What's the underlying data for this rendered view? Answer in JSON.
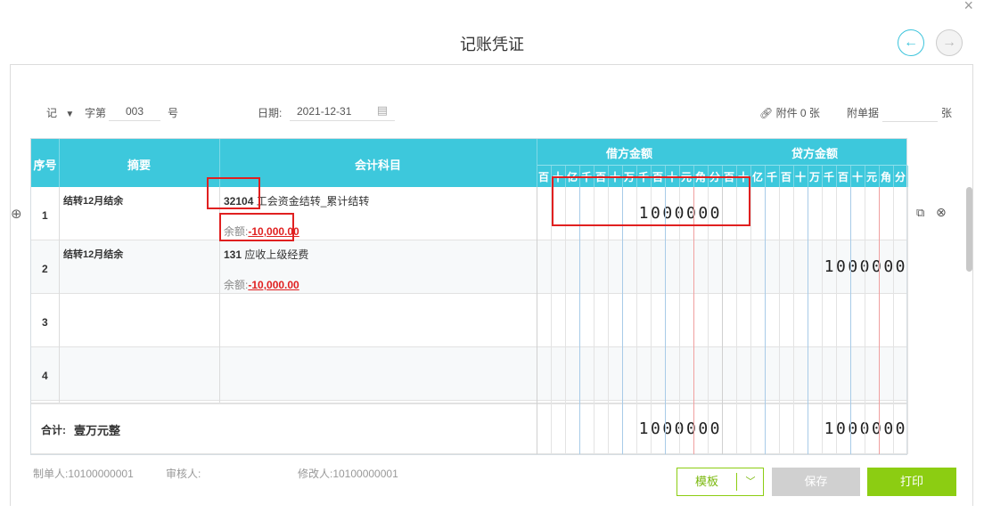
{
  "window": {
    "title": "记账凭证",
    "close_icon": "close-icon",
    "prev_icon": "arrow-left-icon",
    "next_icon": "arrow-right-icon"
  },
  "header": {
    "voucher_type": "记",
    "voucher_word": "字第",
    "voucher_no": "003",
    "voucher_hao": "号",
    "date_label": "日期:",
    "date_value": "2021-12-31",
    "attachment_icon": "link-icon",
    "attachment_text": "附件 0 张",
    "doc_label": "附单据",
    "doc_unit": "张"
  },
  "table": {
    "headers": {
      "seq": "序号",
      "summary": "摘要",
      "account": "会计科目",
      "debit": "借方金额",
      "credit": "贷方金额"
    },
    "digit_units": [
      "百",
      "十",
      "亿",
      "千",
      "百",
      "十",
      "万",
      "千",
      "百",
      "十",
      "元",
      "角",
      "分"
    ],
    "rows": [
      {
        "seq": "1",
        "summary": "结转12月结余",
        "account_code": "32104",
        "account_name": "工会资金结转_累计结转",
        "balance_label": "余额:",
        "balance_value": "-10,000.00",
        "debit": "1000000",
        "credit": ""
      },
      {
        "seq": "2",
        "summary": "结转12月结余",
        "account_code": "131",
        "account_name": "应收上级经费",
        "balance_label": "余额:",
        "balance_value": "-10,000.00",
        "debit": "",
        "credit": "1000000"
      },
      {
        "seq": "3",
        "summary": "",
        "account_code": "",
        "account_name": "",
        "balance_label": "",
        "balance_value": "",
        "debit": "",
        "credit": ""
      },
      {
        "seq": "4",
        "summary": "",
        "account_code": "",
        "account_name": "",
        "balance_label": "",
        "balance_value": "",
        "debit": "",
        "credit": ""
      }
    ],
    "total": {
      "label": "合计:",
      "amount_text": "壹万元整",
      "debit": "1000000",
      "credit": "1000000"
    }
  },
  "footer": {
    "maker": "制单人:10100000001",
    "reviewer": "审核人:",
    "modifier": "修改人:10100000001",
    "template_btn": "模板",
    "save_btn": "保存",
    "print_btn": "打印"
  },
  "colors": {
    "header_bg": "#3dc8dc",
    "print_btn": "#8ccd12",
    "save_btn_disabled": "#d0d0d0",
    "highlight": "#e02020"
  }
}
